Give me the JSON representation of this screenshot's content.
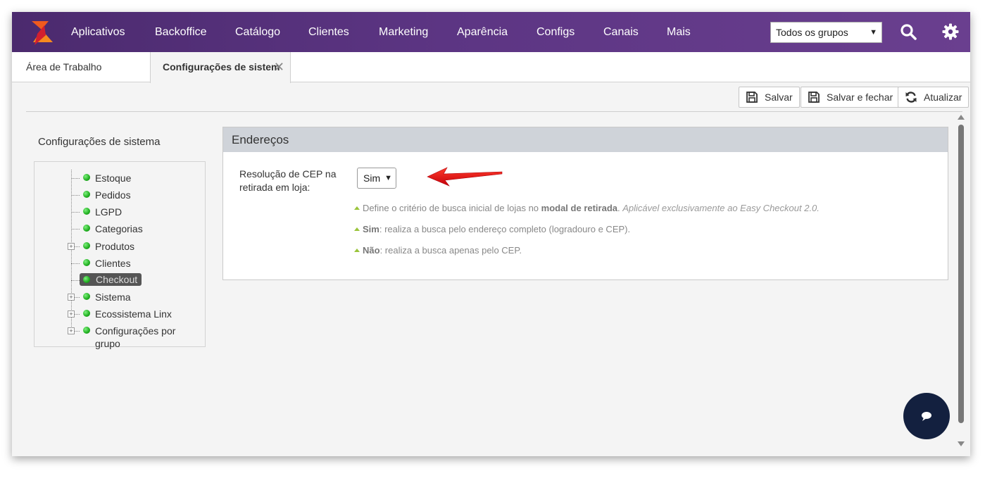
{
  "nav": {
    "items": [
      "Aplicativos",
      "Backoffice",
      "Catálogo",
      "Clientes",
      "Marketing",
      "Aparência",
      "Configs",
      "Canais",
      "Mais"
    ],
    "group_select": "Todos os grupos",
    "brand_colors": {
      "top": "#4b2a6e",
      "logo_orange": "#f05a1e",
      "logo_red": "#d21f2f"
    }
  },
  "tabs": [
    {
      "label": "Área de Trabalho",
      "active": false
    },
    {
      "label": "Configurações de sistem",
      "active": true
    }
  ],
  "toolbar": {
    "save": "Salvar",
    "save_close": "Salvar e fechar",
    "refresh": "Atualizar"
  },
  "sidebar": {
    "title": "Configurações de sistema",
    "items": [
      {
        "label": "Estoque",
        "expandable": false
      },
      {
        "label": "Pedidos",
        "expandable": false
      },
      {
        "label": "LGPD",
        "expandable": false
      },
      {
        "label": "Categorias",
        "expandable": false
      },
      {
        "label": "Produtos",
        "expandable": true
      },
      {
        "label": "Clientes",
        "expandable": false
      },
      {
        "label": "Checkout",
        "expandable": false,
        "selected": true
      },
      {
        "label": "Sistema",
        "expandable": true
      },
      {
        "label": "Ecossistema Linx",
        "expandable": true
      },
      {
        "label": "Configurações por grupo",
        "expandable": true
      }
    ]
  },
  "panel": {
    "title": "Endereços",
    "field_label": "Resolução de CEP na retirada em loja:",
    "field_value": "Sim",
    "help": {
      "line1_pre": "Define o critério de busca inicial de lojas no ",
      "line1_bold": "modal de retirada",
      "line1_post": ". ",
      "line1_italic": "Aplicável exclusivamente ao Easy Checkout 2.0.",
      "line2_bold": "Sim",
      "line2_text": ": realiza a busca pelo endereço completo (logradouro e CEP).",
      "line3_bold": "Não",
      "line3_text": ": realiza a busca apenas pelo CEP."
    }
  }
}
